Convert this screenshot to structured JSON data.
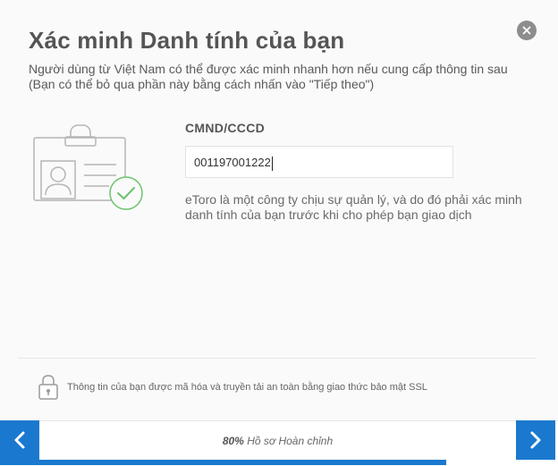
{
  "dialog": {
    "title": "Xác minh Danh tính của bạn",
    "subtitle": "Người dùng từ Việt Nam có thể được xác minh nhanh hơn nếu cung cấp thông tin sau (Bạn có thể bỏ qua phần này bằng cách nhấn vào \"Tiếp theo\")",
    "close_icon": "close-icon",
    "close_glyph": "✕"
  },
  "form": {
    "id_label": "CMND/CCCD",
    "id_value": "001197001222",
    "note": "eToro là một công ty chịu sự quản lý, và do đó phải xác minh danh tính của bạn trước khi cho phép bạn giao dịch"
  },
  "security": {
    "icon": "lock-icon",
    "text": "Thông tin của bạn được mã hóa và truyền tải an toàn bằng giao thức bảo mật SSL"
  },
  "footer": {
    "prev_icon": "chevron-left-icon",
    "next_icon": "chevron-right-icon",
    "progress_percent_label": "80%",
    "progress_label": "Hồ sơ Hoàn chỉnh",
    "progress_value": 0.8
  },
  "colors": {
    "accent": "#1a79cf",
    "success": "#6cc26c",
    "text": "#555555"
  }
}
